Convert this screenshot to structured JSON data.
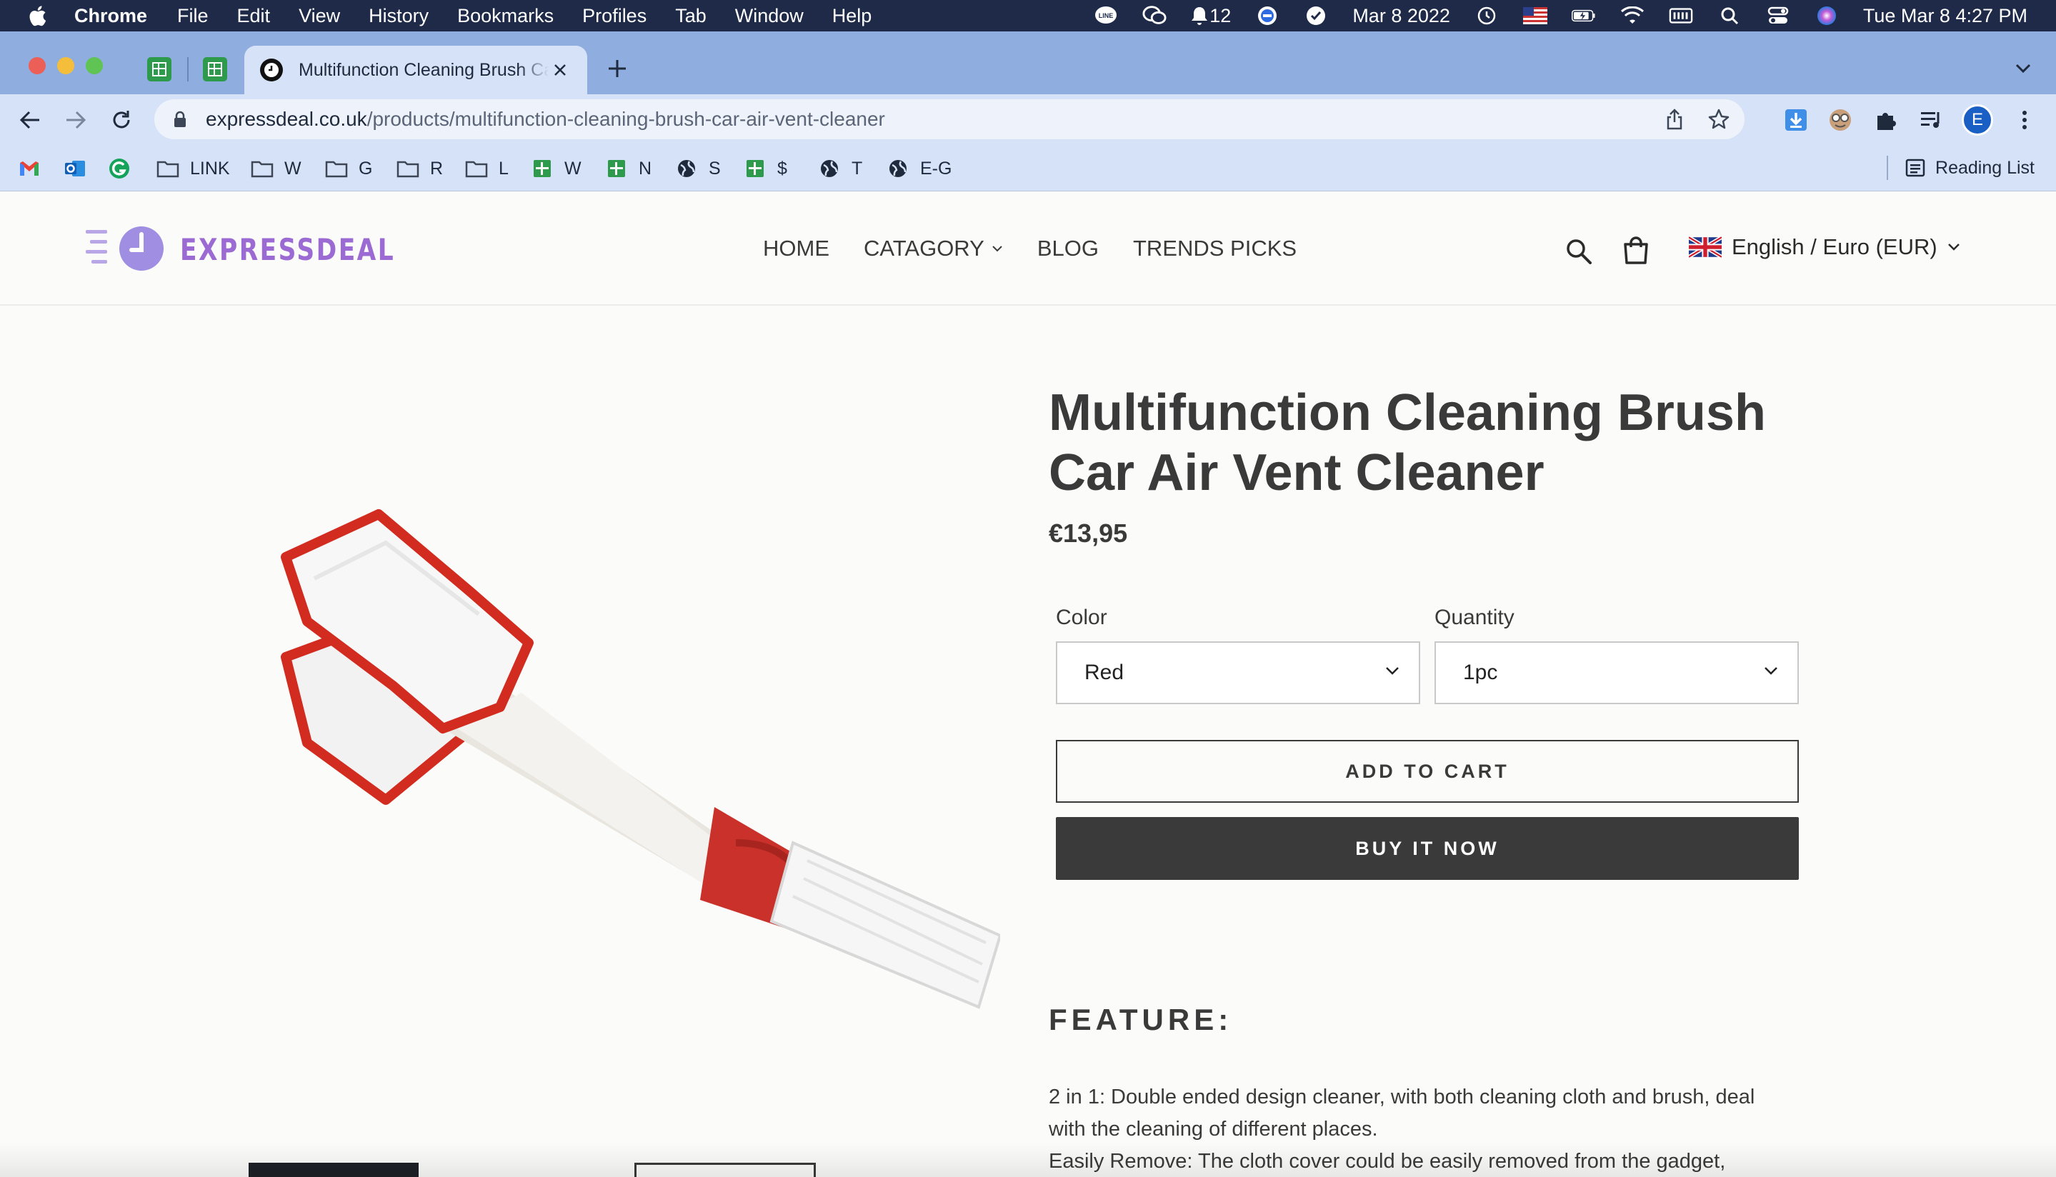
{
  "menubar": {
    "app_name": "Chrome",
    "items": [
      "File",
      "Edit",
      "View",
      "History",
      "Bookmarks",
      "Profiles",
      "Tab",
      "Window",
      "Help"
    ],
    "notification_count": "12",
    "date_short": "Mar 8 2022",
    "clock": "Tue Mar 8  4:27 PM"
  },
  "browser": {
    "active_tab_title": "Multifunction Cleaning Brush Car Air Vent Cleaner",
    "url_domain": "expressdeal.co.uk",
    "url_path": "/products/multifunction-cleaning-brush-car-air-vent-cleaner",
    "profile_initial": "E"
  },
  "bookmarks": {
    "items": [
      {
        "label": "",
        "icon": "gmail-icon"
      },
      {
        "label": "",
        "icon": "outlook-icon"
      },
      {
        "label": "",
        "icon": "grammarly-icon"
      },
      {
        "label": "LINK",
        "icon": "folder-icon"
      },
      {
        "label": "W",
        "icon": "folder-icon"
      },
      {
        "label": "G",
        "icon": "folder-icon"
      },
      {
        "label": "R",
        "icon": "folder-icon"
      },
      {
        "label": "L",
        "icon": "folder-icon"
      },
      {
        "label": "W",
        "icon": "sheets-icon"
      },
      {
        "label": "N",
        "icon": "sheets-icon"
      },
      {
        "label": "S",
        "icon": "globe-icon"
      },
      {
        "label": "$",
        "icon": "sheets-icon"
      },
      {
        "label": "T",
        "icon": "globe-icon"
      },
      {
        "label": "E-G",
        "icon": "globe-icon"
      }
    ],
    "reading_list": "Reading List"
  },
  "site": {
    "logo_text": "EXPRESSDEAL",
    "nav": {
      "home": "HOME",
      "category": "CATAGORY",
      "blog": "BLOG",
      "trends": "TRENDS PICKS"
    },
    "locale": "English / Euro (EUR)"
  },
  "product": {
    "title_line1": "Multifunction Cleaning Brush",
    "title_line2": "Car Air Vent Cleaner",
    "price": "€13,95",
    "color_label": "Color",
    "color_value": "Red",
    "quantity_label": "Quantity",
    "quantity_value": "1pc",
    "add_to_cart": "ADD TO CART",
    "buy_now": "BUY IT NOW",
    "feature_heading": "FEATURE:",
    "feature_line1": "2 in 1: Double ended design cleaner, with both cleaning cloth and brush, deal",
    "feature_line2": "with the cleaning of different places.",
    "feature_line3": "Easily Remove: The cloth cover could be easily removed from the gadget,"
  },
  "colors": {
    "menubar_bg": "#1e2a48",
    "tabstrip_bg": "#8fadde",
    "toolbar_bg": "#d6e2f7",
    "brand_purple": "#9b6ad3",
    "button_dark": "#3a3a3a",
    "product_red": "#d22b1f"
  }
}
